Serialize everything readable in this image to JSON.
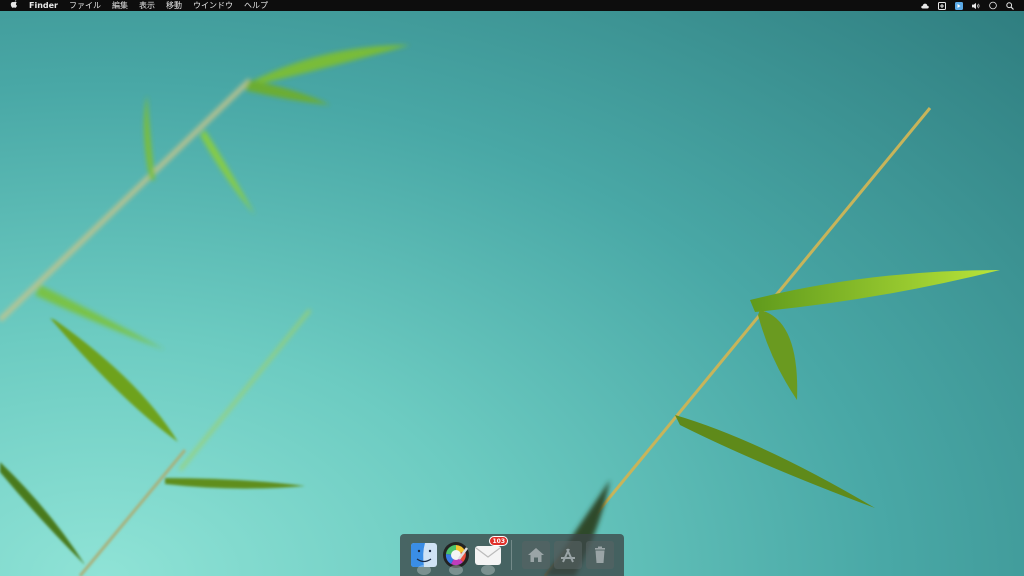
{
  "menubar": {
    "apple": "",
    "app_name": "Finder",
    "menus": [
      "ファイル",
      "編集",
      "表示",
      "移動",
      "ウインドウ",
      "ヘルプ"
    ],
    "status_icons": [
      "cloud-icon",
      "plus-box-icon",
      "badge-icon",
      "volume-icon",
      "circle-icon",
      "search-icon"
    ]
  },
  "dock": {
    "apps": [
      {
        "name": "Finder",
        "icon": "finder-icon"
      },
      {
        "name": "Color Picker",
        "icon": "color-wheel-icon"
      },
      {
        "name": "Mail",
        "icon": "mail-icon",
        "badge": "103"
      }
    ],
    "folders": [
      {
        "name": "Home",
        "icon": "home-icon"
      },
      {
        "name": "Applications",
        "icon": "app-store-icon"
      },
      {
        "name": "Trash",
        "icon": "trash-icon"
      }
    ]
  }
}
